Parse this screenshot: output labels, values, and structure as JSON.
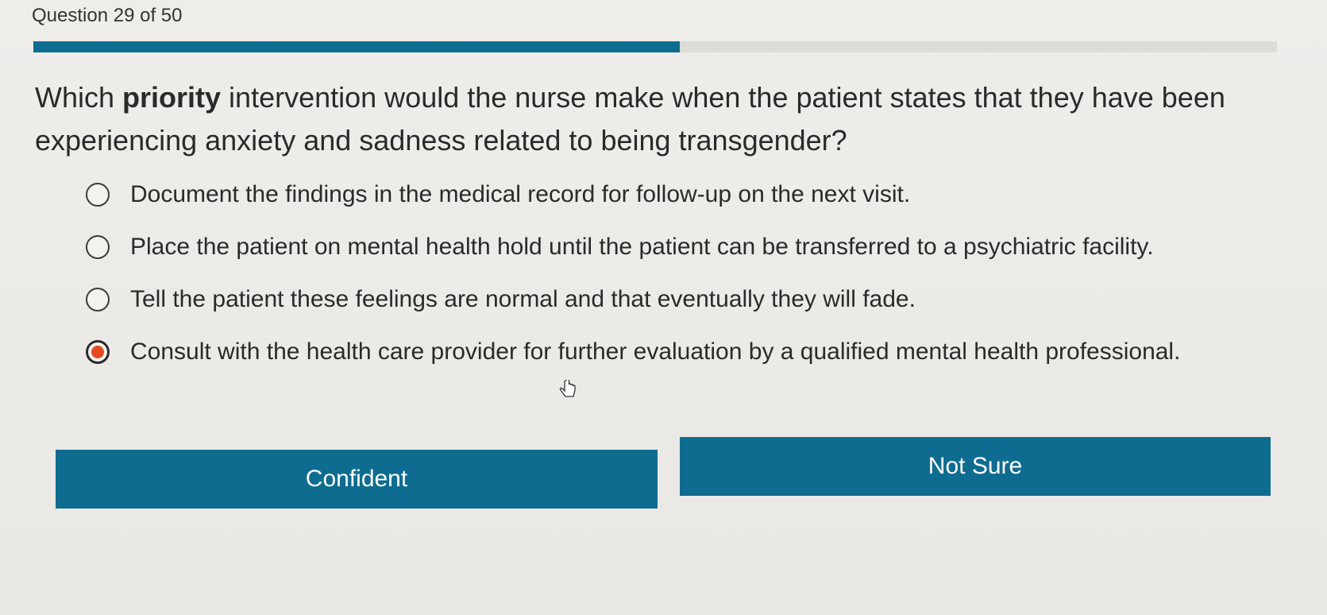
{
  "header": {
    "counter_text": "Question 29 of 50",
    "progress_fraction": 0.52
  },
  "question": {
    "before": "Which ",
    "emphasis": "priority",
    "after": " intervention would the nurse make when the patient states that they have been experiencing anxiety and sadness related to being transgender?"
  },
  "options": [
    {
      "label": "Document the findings in the medical record for follow-up on the next visit.",
      "selected": false
    },
    {
      "label": "Place the patient on mental health hold until the patient can be transferred to a psychiatric facility.",
      "selected": false
    },
    {
      "label": "Tell the patient these feelings are normal and that eventually they will fade.",
      "selected": false
    },
    {
      "label": "Consult with the health care provider for further evaluation by a qualified mental health professional.",
      "selected": true
    }
  ],
  "buttons": {
    "confident_label": "Confident",
    "not_sure_label": "Not Sure"
  },
  "colors": {
    "accent": "#0f6c91",
    "selected_radio": "#e34a1f",
    "progress_track": "#dddcd8"
  },
  "icons": {
    "cursor": "hand-pointer-icon"
  }
}
